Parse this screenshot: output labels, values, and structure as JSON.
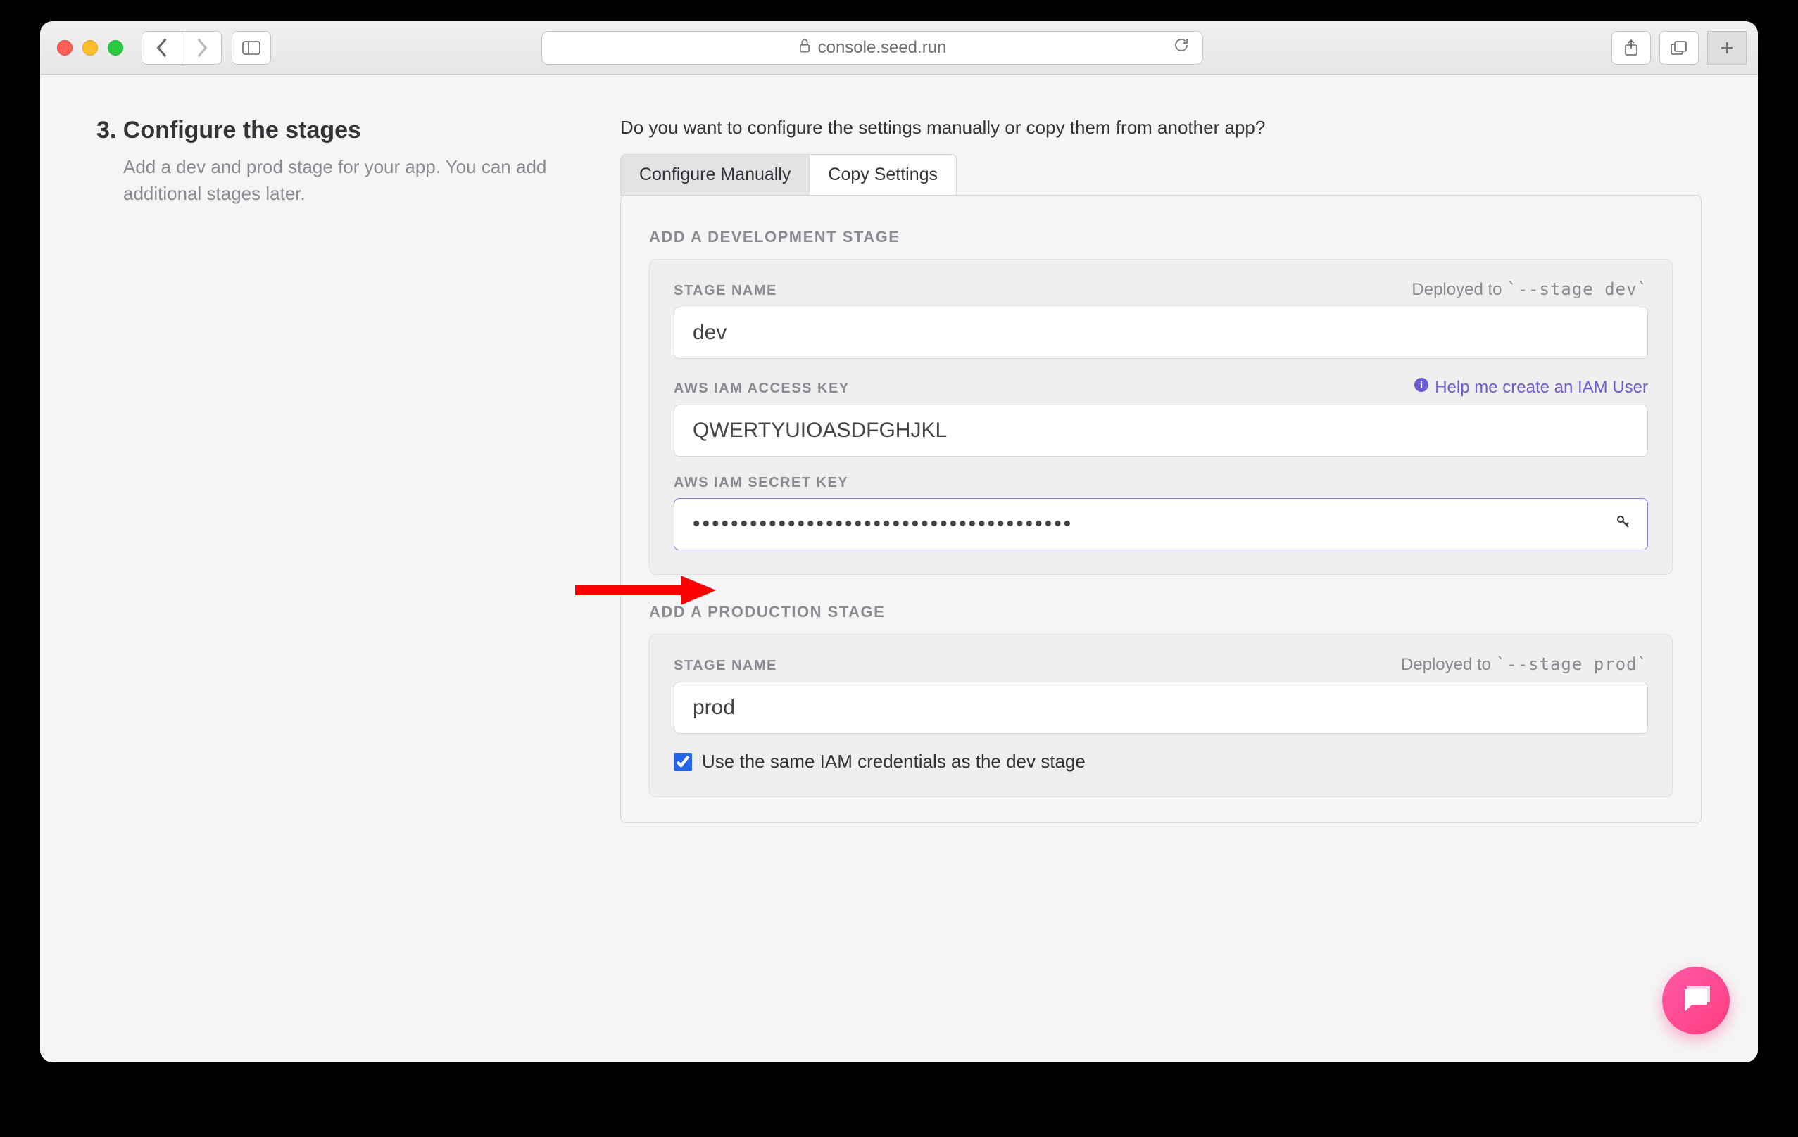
{
  "browser": {
    "url_host": "console.seed.run"
  },
  "step": {
    "heading": "3. Configure the stages",
    "desc": "Add a dev and prod stage for your app. You can add additional stages later."
  },
  "question": "Do you want to configure the settings manually or copy them from another app?",
  "tabs": {
    "configure": "Configure Manually",
    "copy": "Copy Settings"
  },
  "dev": {
    "section": "ADD A DEVELOPMENT STAGE",
    "name_label": "STAGE NAME",
    "deployed_prefix": "Deployed to ",
    "deployed_code": "`--stage dev`",
    "name_value": "dev",
    "access_label": "AWS IAM ACCESS KEY",
    "help": "Help me create an IAM User",
    "access_value": "QWERTYUIOASDFGHJKL",
    "secret_label": "AWS IAM SECRET KEY",
    "secret_value": "••••••••••••••••••••••••••••••••••••••••"
  },
  "prod": {
    "section": "ADD A PRODUCTION STAGE",
    "name_label": "STAGE NAME",
    "deployed_prefix": "Deployed to ",
    "deployed_code": "`--stage prod`",
    "name_value": "prod",
    "same_iam": "Use the same IAM credentials as the dev stage"
  }
}
